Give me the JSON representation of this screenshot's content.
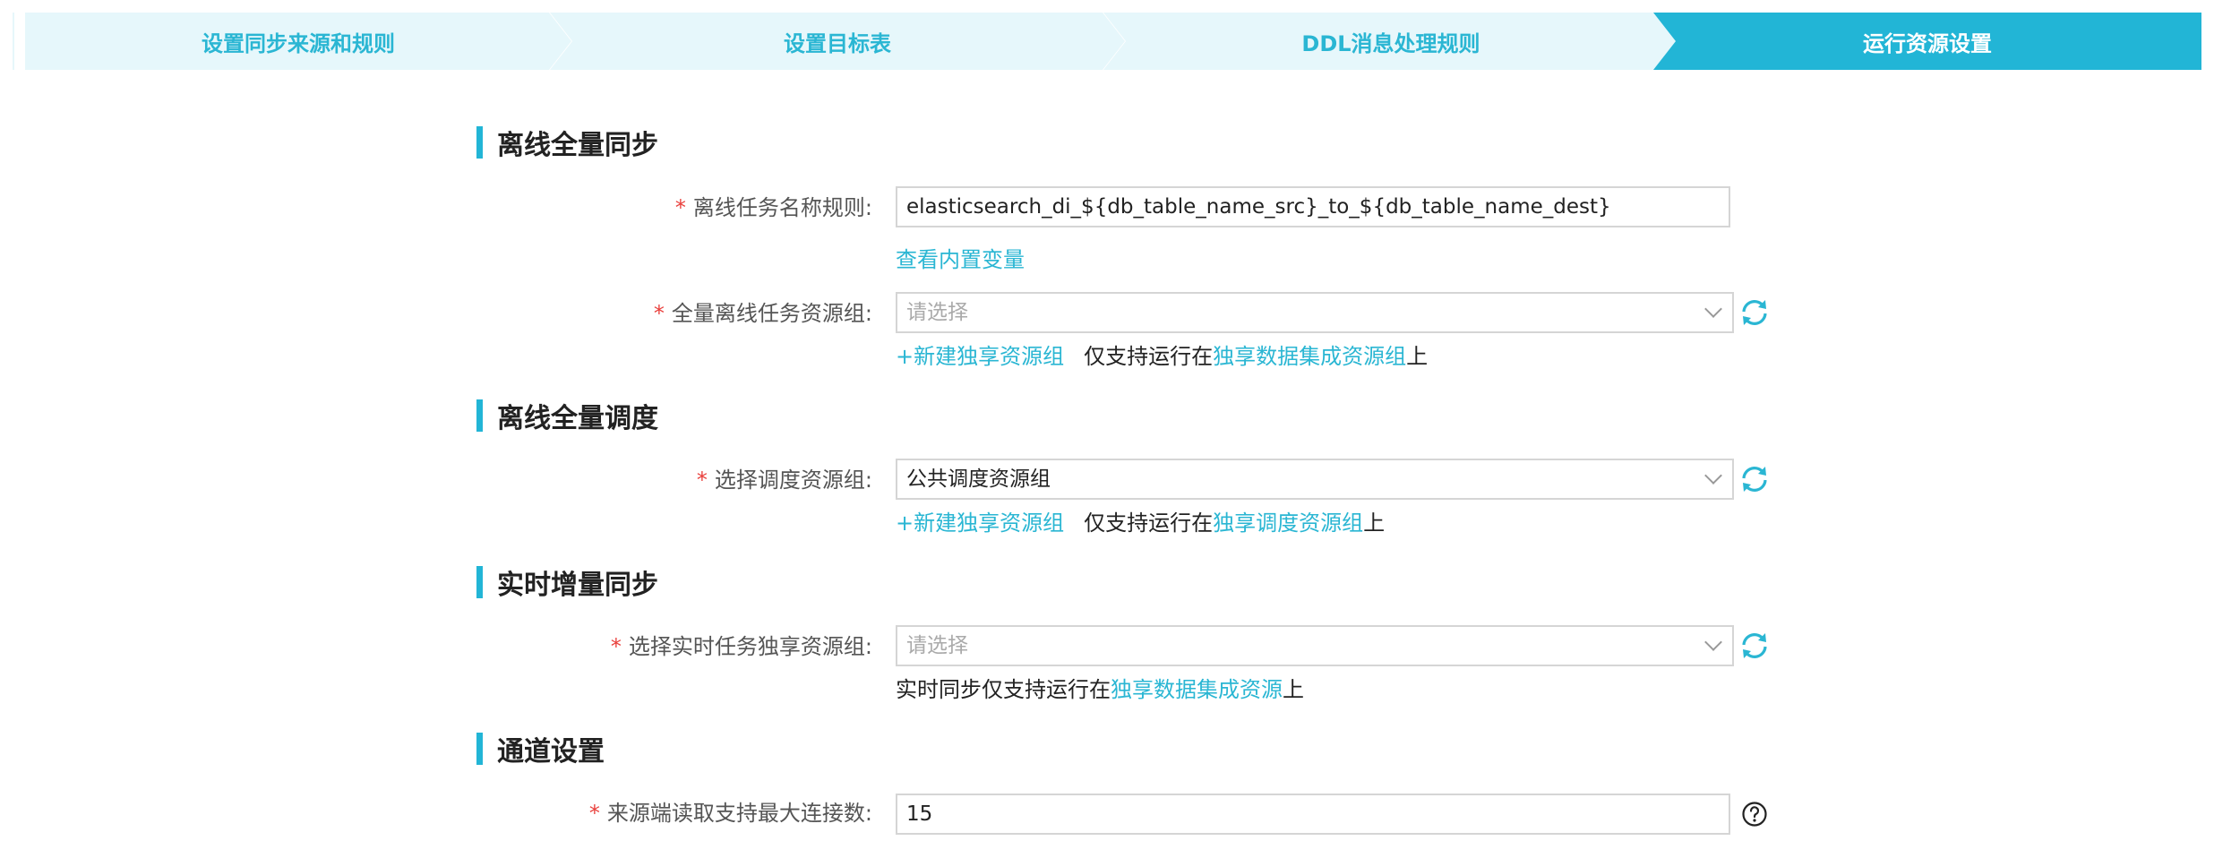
{
  "steps": [
    {
      "label": "设置同步来源和规则"
    },
    {
      "label": "设置目标表"
    },
    {
      "label": "DDL消息处理规则"
    },
    {
      "label": "运行资源设置"
    }
  ],
  "sections": {
    "offline_sync": {
      "title": "离线全量同步",
      "task_name_rule": {
        "label": "离线任务名称规则:",
        "value": "elasticsearch_di_${db_table_name_src}_to_${db_table_name_dest}",
        "view_vars_link": "查看内置变量"
      },
      "resource_group": {
        "label": "全量离线任务资源组:",
        "placeholder": "请选择",
        "new_link": "+新建独享资源组",
        "hint_prefix": "仅支持运行在",
        "hint_link": "独享数据集成资源组",
        "hint_suffix": "上"
      }
    },
    "offline_schedule": {
      "title": "离线全量调度",
      "resource_group": {
        "label": "选择调度资源组:",
        "value": "公共调度资源组",
        "new_link": "+新建独享资源组",
        "hint_prefix": "仅支持运行在",
        "hint_link": "独享调度资源组",
        "hint_suffix": "上"
      }
    },
    "realtime_sync": {
      "title": "实时增量同步",
      "resource_group": {
        "label": "选择实时任务独享资源组:",
        "placeholder": "请选择",
        "hint_prefix": "实时同步仅支持运行在",
        "hint_link": "独享数据集成资源",
        "hint_suffix": "上"
      }
    },
    "channel": {
      "title": "通道设置",
      "max_connections": {
        "label": "来源端读取支持最大连接数:",
        "value": "15"
      }
    }
  },
  "required_mark": "*",
  "colors": {
    "accent": "#22b5d6",
    "accent_light": "#e6f7fb",
    "required": "#e9403c"
  }
}
